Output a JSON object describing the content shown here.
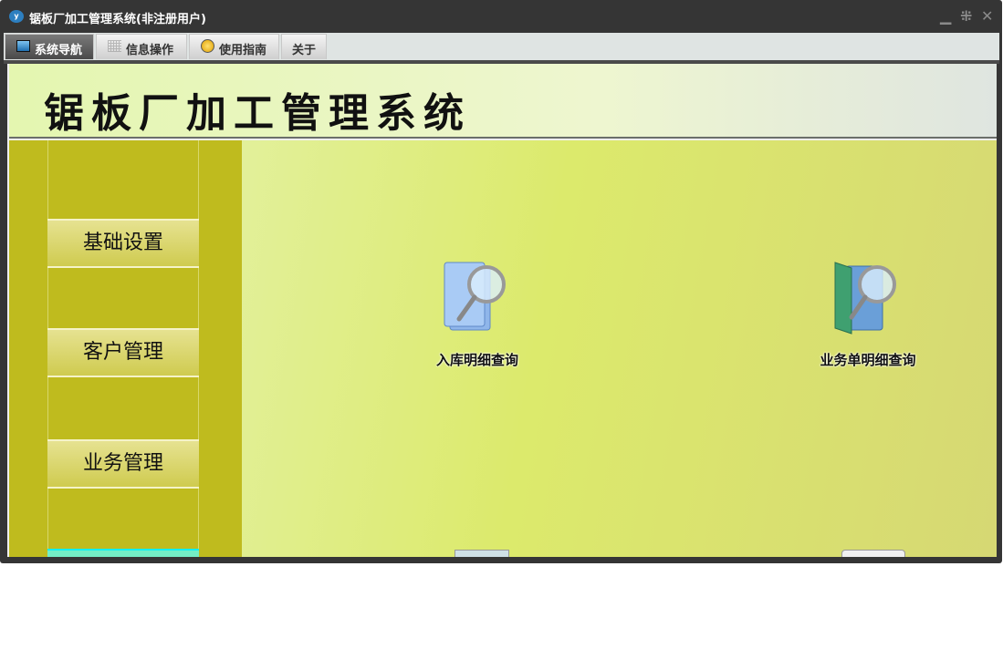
{
  "window": {
    "title": "锯板厂加工管理系统(非注册用户)",
    "controls": [
      "minimize",
      "restore",
      "close"
    ]
  },
  "tabs": [
    {
      "label": "系统导航",
      "icon": "monitor-icon",
      "active": true
    },
    {
      "label": "信息操作",
      "icon": "grid-icon"
    },
    {
      "label": "使用指南",
      "icon": "help-icon"
    },
    {
      "label": "关于"
    }
  ],
  "banner": {
    "title": "锯板厂加工管理系统"
  },
  "sidebar": {
    "items": [
      {
        "label": "基础设置"
      },
      {
        "label": "客户管理"
      },
      {
        "label": "业务管理"
      }
    ]
  },
  "main": {
    "items": [
      {
        "label": "入库明细查询",
        "icon": "document-search-icon"
      },
      {
        "label": "业务单明细查询",
        "icon": "folder-search-icon"
      }
    ]
  },
  "colors": {
    "sidebar": "#bfbb1e",
    "accent": "#74eec6"
  }
}
